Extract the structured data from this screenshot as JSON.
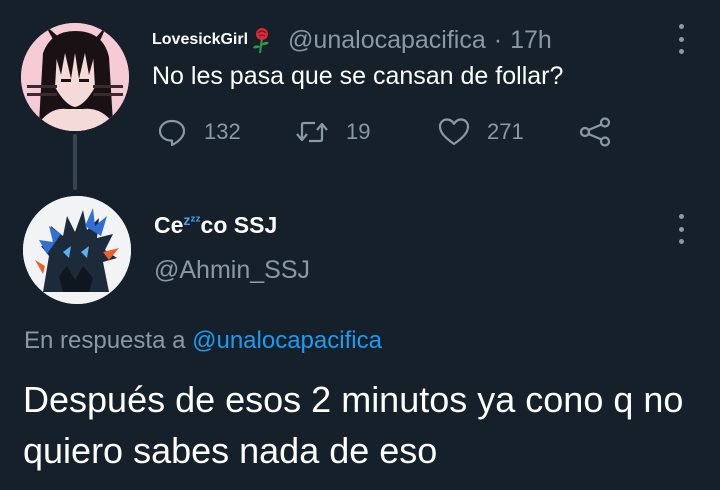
{
  "parent_tweet": {
    "display_name": "LovesickGirl",
    "handle": "@unalocapacifica",
    "separator": "·",
    "time": "17h",
    "text": "No les pasa que se cansan de follar?",
    "reply_count": "132",
    "retweet_count": "19",
    "like_count": "271"
  },
  "reply_tweet": {
    "display_name_start": "Ce",
    "display_name_zzz": "zᶻᶻ",
    "display_name_end": "co SSJ",
    "handle": "@Ahmin_SSJ",
    "in_reply_to_prefix": "En respuesta a",
    "in_reply_to_handle": "@unalocapacifica",
    "text": "Después de esos 2 minutos ya cono q no quiero sabes nada de eso"
  },
  "icons": {
    "rose": "rose-icon",
    "more": "more-dots-icon",
    "reply": "reply-bubble-icon",
    "retweet": "retweet-icon",
    "like": "heart-icon",
    "share": "share-icon"
  },
  "colors": {
    "background": "#15202b",
    "text_primary": "#ffffff",
    "text_secondary": "#8b98a5",
    "link": "#1d9bf0",
    "thread_line": "#38444d"
  }
}
